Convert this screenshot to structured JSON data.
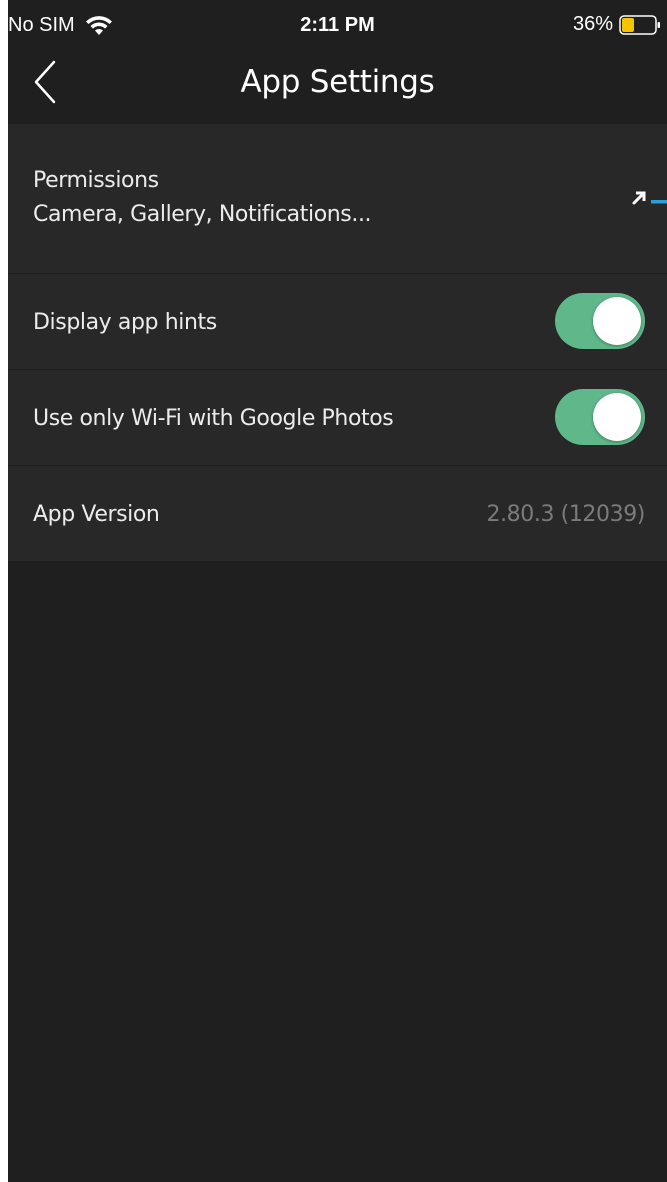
{
  "status_bar": {
    "carrier": "No SIM",
    "time": "2:11 PM",
    "battery_percent": "36%",
    "battery_level": 0.36,
    "battery_color": "#f5c400",
    "wifi_icon": "wifi-icon"
  },
  "nav": {
    "title": "App Settings",
    "back_icon": "chevron-left-icon"
  },
  "settings": {
    "permissions": {
      "title": "Permissions",
      "subtitle": "Camera, Gallery, Notifications...",
      "icon": "external-link-icon"
    },
    "display_hints": {
      "label": "Display app hints",
      "enabled": true
    },
    "wifi_only": {
      "label": "Use only Wi-Fi with Google Photos",
      "enabled": true
    },
    "app_version": {
      "label": "App Version",
      "value": "2.80.3 (12039)"
    }
  },
  "colors": {
    "background": "#1f1f1f",
    "row_background": "#282828",
    "toggle_on": "#5fb88a",
    "accent_blue": "#2a9fd8"
  }
}
